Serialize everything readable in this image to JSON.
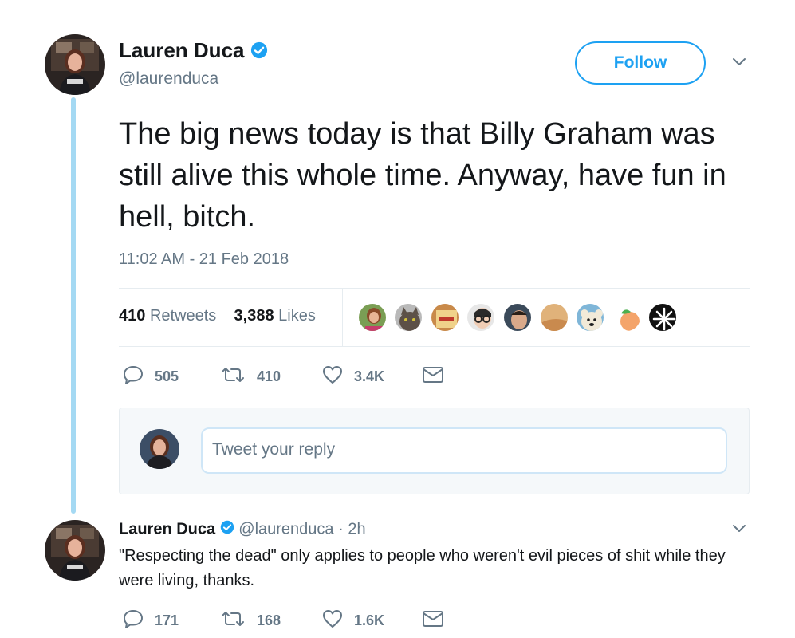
{
  "tweet": {
    "author_name": "Lauren Duca",
    "author_handle": "@laurenduca",
    "follow_label": "Follow",
    "text": "The big news today is that Billy Graham was still alive this whole time. Anyway, have fun in hell, bitch.",
    "timestamp": "11:02 AM - 21 Feb 2018",
    "retweets_count": "410",
    "retweets_label": "Retweets",
    "likes_count": "3,388",
    "likes_label": "Likes",
    "actions": {
      "replies": "505",
      "retweets": "410",
      "likes": "3.4K"
    },
    "reply_placeholder": "Tweet your reply"
  },
  "reply": {
    "author_name": "Lauren Duca",
    "author_handle": "@laurenduca",
    "separator": "·",
    "time": "2h",
    "text": "\"Respecting the dead\" only applies to people who weren't evil pieces of shit while they were living, thanks.",
    "actions": {
      "replies": "171",
      "retweets": "168",
      "likes": "1.6K"
    }
  },
  "colors": {
    "brand_blue": "#1da1f2",
    "thread_line": "#a4d9f3",
    "muted_text": "#657786",
    "primary_text": "#14171a"
  },
  "icons": [
    "verified-badge-icon",
    "chevron-down-icon",
    "reply-icon",
    "retweet-icon",
    "like-icon",
    "message-icon"
  ]
}
